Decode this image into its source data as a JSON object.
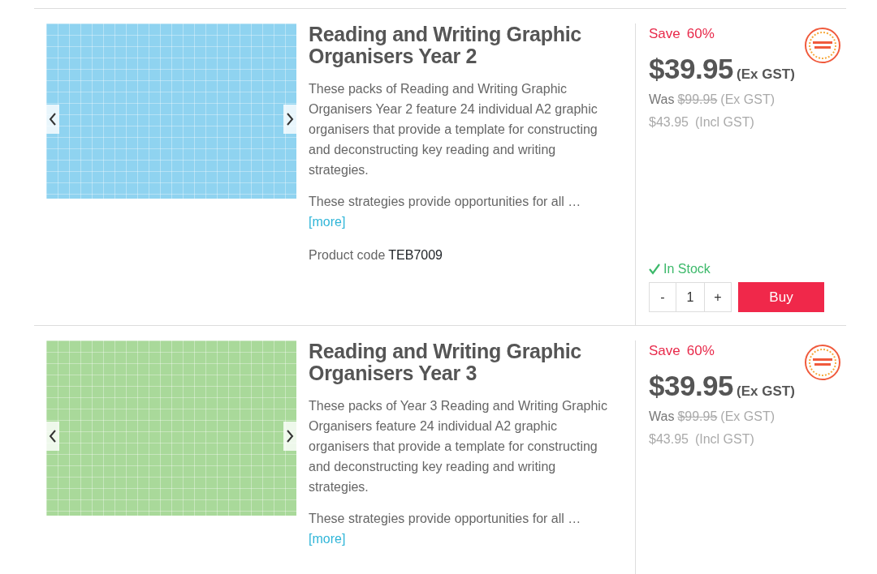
{
  "products": [
    {
      "title": "Reading and Writing Graphic Organisers Year 2",
      "color": "#8fd3f0",
      "description": [
        "These packs of Reading and Writing Graphic Organisers Year 2 feature 24 individual A2 graphic organisers that provide a template for constructing and deconstructing key reading and writing strategies.",
        "These strategies provide opportunities for all …"
      ],
      "more": "[more]",
      "code_label": "Product code",
      "code": "TEB7009",
      "save_label": "Save",
      "save": "60%",
      "price": "$39.95",
      "price_note": "(Ex GST)",
      "was_label": "Was",
      "was": "$99.95",
      "was_note": "(Ex GST)",
      "incl": "$43.95",
      "incl_note": "(Incl GST)",
      "stock": "In Stock",
      "quantity": {
        "minus": "-",
        "value": "1",
        "plus": "+"
      },
      "buy": "Buy"
    },
    {
      "title": "Reading and Writing Graphic Organisers Year 3",
      "color": "#a9d99a",
      "description": [
        "These packs of Year 3 Reading and Writing Graphic Organisers feature 24 individual A2 graphic organisers that provide a template for constructing and deconstructing key reading and writing strategies.",
        "These strategies provide opportunities for all …"
      ],
      "more": "[more]",
      "save_label": "Save",
      "save": "60%",
      "price": "$39.95",
      "price_note": "(Ex GST)",
      "was_label": "Was",
      "was": "$99.95",
      "was_note": "(Ex GST)",
      "incl": "$43.95",
      "incl_note": "(Incl GST)"
    }
  ]
}
